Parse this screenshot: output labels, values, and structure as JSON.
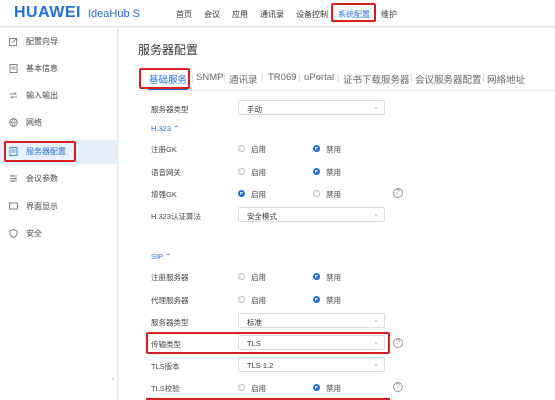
{
  "header": {
    "brand": "HUAWEI",
    "product": "IdeaHub S",
    "nav": [
      {
        "label": "首页"
      },
      {
        "label": "会议"
      },
      {
        "label": "应用"
      },
      {
        "label": "通讯录"
      },
      {
        "label": "设备控制"
      },
      {
        "label": "系统配置"
      },
      {
        "label": "维护"
      }
    ],
    "active_nav": "系统配置"
  },
  "sidebar": {
    "items": [
      {
        "label": "配置向导",
        "icon": "edit-icon"
      },
      {
        "label": "基本信息",
        "icon": "document-icon"
      },
      {
        "label": "输入输出",
        "icon": "io-icon"
      },
      {
        "label": "网络",
        "icon": "globe-icon"
      },
      {
        "label": "服务器配置",
        "icon": "server-icon"
      },
      {
        "label": "会议参数",
        "icon": "sliders-icon"
      },
      {
        "label": "界面显示",
        "icon": "display-icon"
      },
      {
        "label": "安全",
        "icon": "shield-icon"
      }
    ],
    "active": "服务器配置"
  },
  "main": {
    "title": "服务器配置",
    "tabs": [
      {
        "label": "基础服务"
      },
      {
        "label": "SNMP"
      },
      {
        "label": "通讯录"
      },
      {
        "label": "TR069"
      },
      {
        "label": "uPortal"
      },
      {
        "label": "证书下载服务器"
      },
      {
        "label": "会议服务器配置"
      },
      {
        "label": "网络地址"
      }
    ],
    "tab_separator": "|",
    "active_tab": "基础服务",
    "server_type": {
      "label": "服务器类型",
      "value": "手动"
    },
    "h323": {
      "header": "H.323",
      "collapse_glyph": "⌃",
      "rows": [
        {
          "label": "注册GK",
          "options": [
            "启用",
            "禁用"
          ],
          "selected": "禁用"
        },
        {
          "label": "语音网关",
          "options": [
            "启用",
            "禁用"
          ],
          "selected": "禁用"
        },
        {
          "label": "增强GK",
          "options": [
            "启用",
            "禁用"
          ],
          "selected": "启用",
          "help": "?"
        }
      ],
      "auth": {
        "label": "H.323认证算法",
        "value": "安全模式"
      }
    },
    "sip": {
      "header": "SIP",
      "collapse_glyph": "⌃",
      "rows": [
        {
          "label": "注册服务器",
          "options": [
            "启用",
            "禁用"
          ],
          "selected": "禁用"
        },
        {
          "label": "代理服务器",
          "options": [
            "启用",
            "禁用"
          ],
          "selected": "禁用"
        }
      ],
      "server_type": {
        "label": "服务器类型",
        "value": "标准"
      },
      "transport": {
        "label": "传输类型",
        "value": "TLS",
        "help": "?"
      },
      "tls_version": {
        "label": "TLS版本",
        "value": "TLS 1.2"
      },
      "tls_check": {
        "label": "TLS校验",
        "options": [
          "启用",
          "禁用"
        ],
        "selected": "禁用",
        "help": "?"
      }
    }
  },
  "accent_color": "#1f6fd6",
  "highlight_color": "#d81e1e"
}
